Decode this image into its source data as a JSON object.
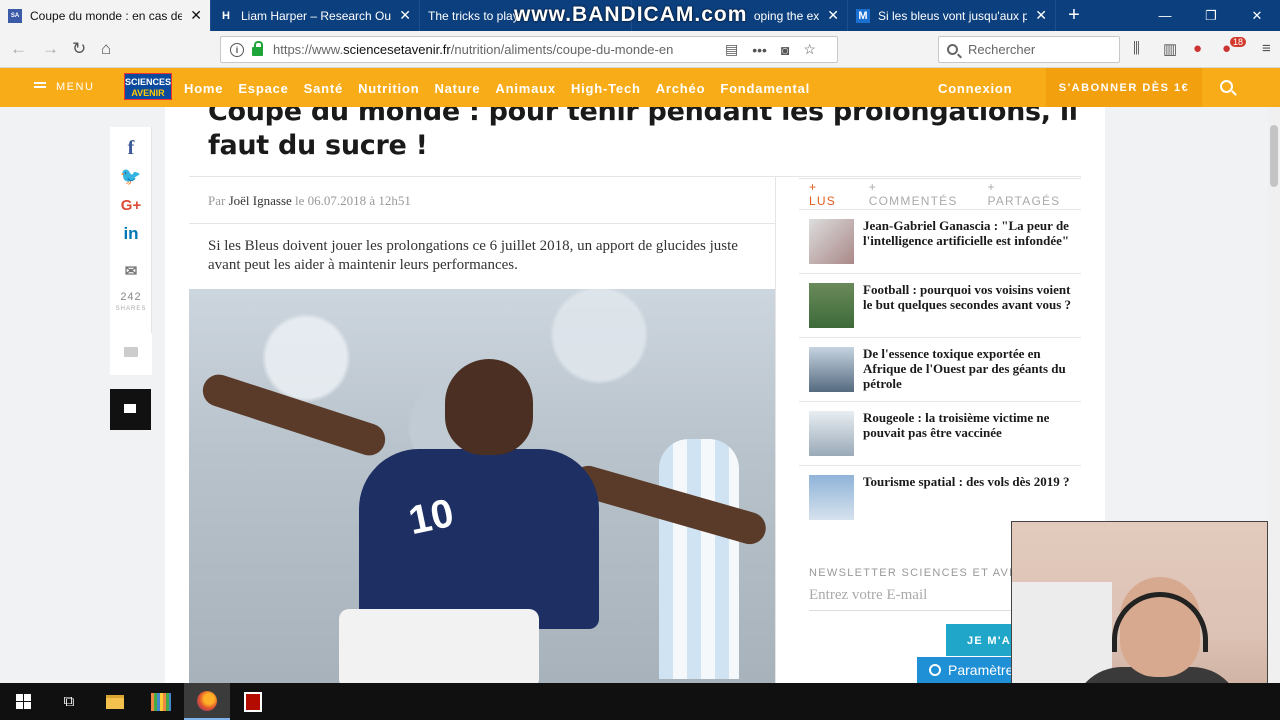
{
  "browser": {
    "tabs": [
      {
        "title": "Coupe du monde : en cas de p",
        "favicon": "sciences-avenir-icon",
        "active": true
      },
      {
        "title": "Liam Harper – Research Outpu",
        "favicon": "H",
        "active": false
      },
      {
        "title": "The tricks to play",
        "favicon": "",
        "active": false
      },
      {
        "title": "oping the ex",
        "favicon": "",
        "active": false
      },
      {
        "title": "Si les bleus vont jusqu'aux prol",
        "favicon": "M",
        "active": false
      }
    ],
    "watermark": "www.BANDICAM.com",
    "url": {
      "prefix": "https://www.",
      "domain": "sciencesetavenir.fr",
      "path": "/nutrition/aliments/coupe-du-monde-en"
    },
    "search_placeholder": "Rechercher",
    "badge": "18",
    "new_tab": "+"
  },
  "site": {
    "menu_label": "MENU",
    "logo_line1": "SCIENCES",
    "logo_line2": "AVENIR",
    "nav": [
      "Home",
      "Espace",
      "Santé",
      "Nutrition",
      "Nature",
      "Animaux",
      "High-Tech",
      "Archéo",
      "Fondamental"
    ],
    "login": "Connexion",
    "subscribe": "S'ABONNER DÈS 1€"
  },
  "article": {
    "title": "Coupe du monde : pour tenir pendant les prolongations, il faut du sucre !",
    "byline_prefix": "Par",
    "author": "Joël Ignasse",
    "date": "le 06.07.2018 à 12h51",
    "lead": "Si les Bleus doivent jouer les prolongations ce 6 juillet 2018, un apport de glucides juste avant peut les aider à maintenir leurs performances.",
    "photo_jersey_number": "10"
  },
  "share": {
    "count": "242",
    "count_label": "SHARES",
    "icons": [
      "facebook-icon",
      "twitter-icon",
      "google-plus-icon",
      "linkedin-icon",
      "email-icon"
    ]
  },
  "sidebar": {
    "tabs": [
      "+ LUS",
      "+ COMMENTÉS",
      "+ PARTAGÉS"
    ],
    "items": [
      {
        "title": "Jean-Gabriel Ganascia : \"La peur de l'intelligence artificielle est infondée\""
      },
      {
        "title": "Football : pourquoi vos voisins voient le but quelques secondes avant vous ?"
      },
      {
        "title": "De l'essence toxique exportée en Afrique de l'Ouest par des géants du pétrole"
      },
      {
        "title": "Rougeole : la troisième victime ne pouvait pas être vaccinée"
      },
      {
        "title": "Tourisme spatial : des vols dès 2019 ?"
      }
    ],
    "newsletter_label": "NEWSLETTER SCIENCES ET AVENIR",
    "newsletter_placeholder": "Entrez votre E-mail",
    "newsletter_button": "JE M'ABONNE",
    "params_button": "Paramètres"
  },
  "colors": {
    "site_orange": "#f8ac18",
    "tab_blue": "#0c3f7e",
    "accent_red": "#e25c1f",
    "button_teal": "#20a6c8"
  }
}
